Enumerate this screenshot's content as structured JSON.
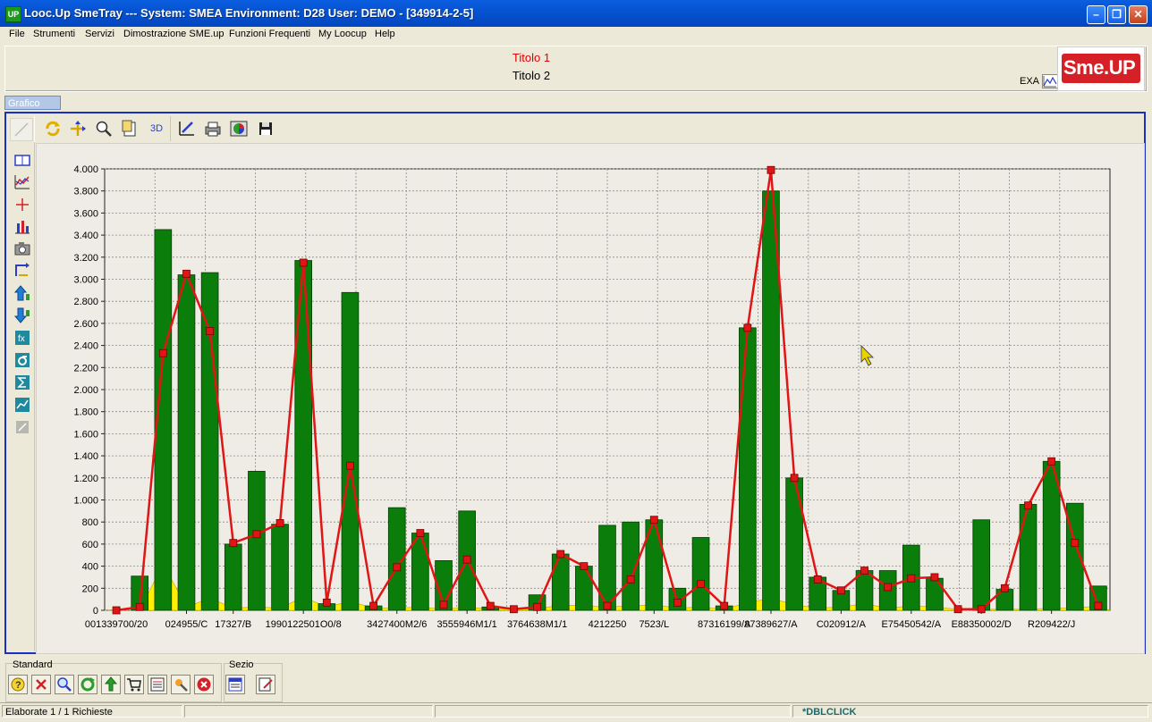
{
  "window": {
    "title": "Looc.Up SmeTray --- System: SMEA Environment: D28 User: DEMO - [349914-2-5]",
    "icon_text": "UP",
    "controls": [
      "minimize-icon",
      "maximize-icon",
      "close-icon"
    ]
  },
  "menu": [
    "File",
    "Strumenti",
    "Servizi",
    "Dimostrazione SME.up",
    "Funzioni Frequenti",
    "My Loocup",
    "Help"
  ],
  "header": {
    "title1": "Titolo 1",
    "title2": "Titolo 2",
    "exa": "EXA",
    "logo": "Sme.UP"
  },
  "tab": {
    "label": "Grafico"
  },
  "toolbar": {
    "top_icons": [
      "pointer-icon",
      "refresh-icon",
      "move-icon",
      "zoom-icon",
      "page-icon",
      "3d-icon",
      "edit-chart-icon",
      "print-icon",
      "palette-icon",
      "save-icon"
    ],
    "label_3d": "3D",
    "left_icons": [
      "book-icon",
      "line-chart-icon",
      "crosshair-icon",
      "bar-chart-icon",
      "camera-icon",
      "sort-icon",
      "up-arrow-icon",
      "down-arrow-icon",
      "function-icon",
      "sigma-icon",
      "sum-icon",
      "trend-icon",
      "disabled-icon"
    ]
  },
  "colors": {
    "bar": "#0a7d0a",
    "line": "#e01616",
    "marker": "#e01616",
    "area": "#ffef00",
    "window_title": "#0653d2",
    "panel_border": "#1a2fc4",
    "title1": "#e00000"
  },
  "chart_data": {
    "type": "bar",
    "title": "",
    "xlabel": "",
    "ylabel": "",
    "ylim": [
      0,
      4000
    ],
    "yticks": [
      "4.000",
      "3.800",
      "3.600",
      "3.400",
      "3.200",
      "3.000",
      "2.800",
      "2.600",
      "2.400",
      "2.200",
      "2.000",
      "1.800",
      "1.600",
      "1.400",
      "1.200",
      "1.000",
      "800",
      "600",
      "400",
      "200",
      "0"
    ],
    "xtick_labels": [
      "001339700/20",
      "024955/C",
      "17327/B",
      "1990122501O0/8",
      "3427400M2/6",
      "3555946M1/1",
      "3764638M1/1",
      "4212250",
      "7523/L",
      "87316199/A",
      "87389627/A",
      "C020912/A",
      "E75450542/A",
      "E88350002/D",
      "R209422/J"
    ],
    "grid": true,
    "series": [
      {
        "type": "bar",
        "values": [
          0,
          310,
          3450,
          3040,
          3060,
          600,
          1260,
          780,
          3170,
          60,
          2880,
          40,
          930,
          700,
          450,
          900,
          30,
          0,
          140,
          510,
          400,
          770,
          800,
          820,
          200,
          660,
          40,
          2560,
          3800,
          1200,
          300,
          180,
          360,
          360,
          590,
          290,
          0,
          820,
          190,
          960,
          1350,
          970,
          220
        ]
      },
      {
        "type": "line",
        "values": [
          0,
          30,
          2330,
          3050,
          2530,
          610,
          690,
          790,
          3150,
          70,
          1310,
          40,
          390,
          700,
          50,
          460,
          40,
          10,
          30,
          510,
          400,
          40,
          280,
          820,
          70,
          240,
          40,
          2560,
          3990,
          1200,
          280,
          180,
          360,
          210,
          290,
          300,
          10,
          10,
          200,
          950,
          1350,
          610,
          40
        ]
      },
      {
        "type": "area",
        "values": [
          0,
          0,
          420,
          30,
          110,
          20,
          30,
          20,
          120,
          30,
          80,
          20,
          20,
          30,
          10,
          30,
          10,
          10,
          10,
          50,
          40,
          30,
          40,
          50,
          20,
          30,
          10,
          70,
          110,
          50,
          20,
          30,
          60,
          20,
          40,
          30,
          10,
          10,
          10,
          10,
          20,
          20,
          40
        ]
      }
    ]
  },
  "bottom_toolbar": {
    "group1_label": "Standard",
    "group1_icons": [
      "help-icon",
      "cancel-icon",
      "search-icon",
      "refresh-icon",
      "export-icon",
      "cart-icon",
      "list-icon",
      "tools-icon",
      "stop-icon"
    ],
    "group2_label": "Sezio",
    "group2_icons": [
      "table-icon",
      "edit-icon"
    ]
  },
  "status": {
    "left": "Elaborate 1 / 1 Richieste",
    "right": "*DBLCLICK"
  }
}
